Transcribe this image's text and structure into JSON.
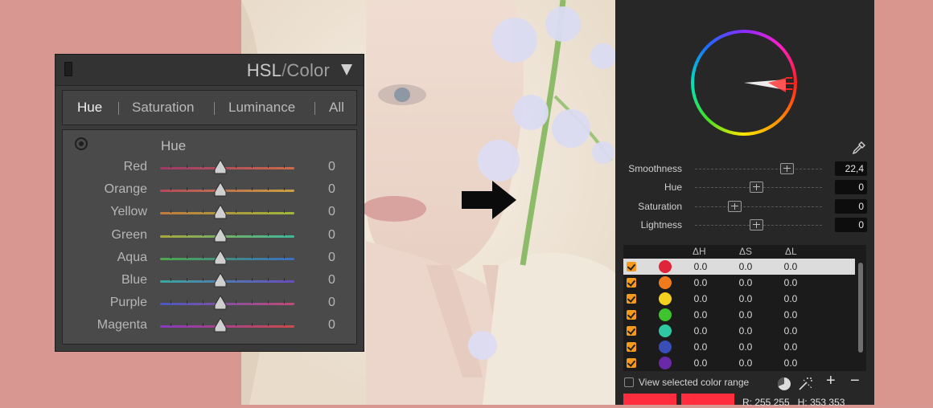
{
  "hsl_panel": {
    "title": "HSL",
    "title_sep": "/",
    "title_sub": "Color",
    "tabs": [
      {
        "label": "Hue",
        "active": true
      },
      {
        "label": "Saturation",
        "active": false
      },
      {
        "label": "Luminance",
        "active": false
      },
      {
        "label": "All",
        "active": false
      }
    ],
    "section_label": "Hue",
    "sliders": [
      {
        "label": "Red",
        "value": "0",
        "colors": [
          "#a0386a",
          "#cc6a4a"
        ]
      },
      {
        "label": "Orange",
        "value": "0",
        "colors": [
          "#b5485a",
          "#c9a242"
        ]
      },
      {
        "label": "Yellow",
        "value": "0",
        "colors": [
          "#c07a3a",
          "#9db83a"
        ]
      },
      {
        "label": "Green",
        "value": "0",
        "colors": [
          "#a8a83a",
          "#3eb79a"
        ]
      },
      {
        "label": "Aqua",
        "value": "0",
        "colors": [
          "#4caa4a",
          "#3a6fc0"
        ]
      },
      {
        "label": "Blue",
        "value": "0",
        "colors": [
          "#3aa6a0",
          "#6a4ac0"
        ]
      },
      {
        "label": "Purple",
        "value": "0",
        "colors": [
          "#4a58c4",
          "#c04a78"
        ]
      },
      {
        "label": "Magenta",
        "value": "0",
        "colors": [
          "#8a3ac0",
          "#cc4a4a"
        ]
      }
    ]
  },
  "color_panel": {
    "params": [
      {
        "label": "Smoothness",
        "value": "22,4",
        "knob": 0.72
      },
      {
        "label": "Hue",
        "value": "0",
        "knob": 0.48
      },
      {
        "label": "Saturation",
        "value": "0",
        "knob": 0.31
      },
      {
        "label": "Lightness",
        "value": "0",
        "knob": 0.48
      }
    ],
    "list_headers": [
      "ΔH",
      "ΔS",
      "ΔL"
    ],
    "list_rows": [
      {
        "color": "#e0243a",
        "dh": "0.0",
        "ds": "0.0",
        "dl": "0.0",
        "selected": true
      },
      {
        "color": "#f07a1e",
        "dh": "0.0",
        "ds": "0.0",
        "dl": "0.0",
        "selected": false
      },
      {
        "color": "#f2d21e",
        "dh": "0.0",
        "ds": "0.0",
        "dl": "0.0",
        "selected": false
      },
      {
        "color": "#3ec42e",
        "dh": "0.0",
        "ds": "0.0",
        "dl": "0.0",
        "selected": false
      },
      {
        "color": "#2ec8a4",
        "dh": "0.0",
        "ds": "0.0",
        "dl": "0.0",
        "selected": false
      },
      {
        "color": "#3a4eb8",
        "dh": "0.0",
        "ds": "0.0",
        "dl": "0.0",
        "selected": false
      },
      {
        "color": "#6a2aa8",
        "dh": "0.0",
        "ds": "0.0",
        "dl": "0.0",
        "selected": false
      }
    ],
    "view_label": "View selected color range",
    "plus_label": "+",
    "minus_label": "−",
    "rgb_readout": "R: 255 255",
    "h_readout": "H: 353 353",
    "swatch_color": "#ff2d3e"
  },
  "colors": {
    "background": "#d89891",
    "accent_check": "#f59a1d"
  }
}
